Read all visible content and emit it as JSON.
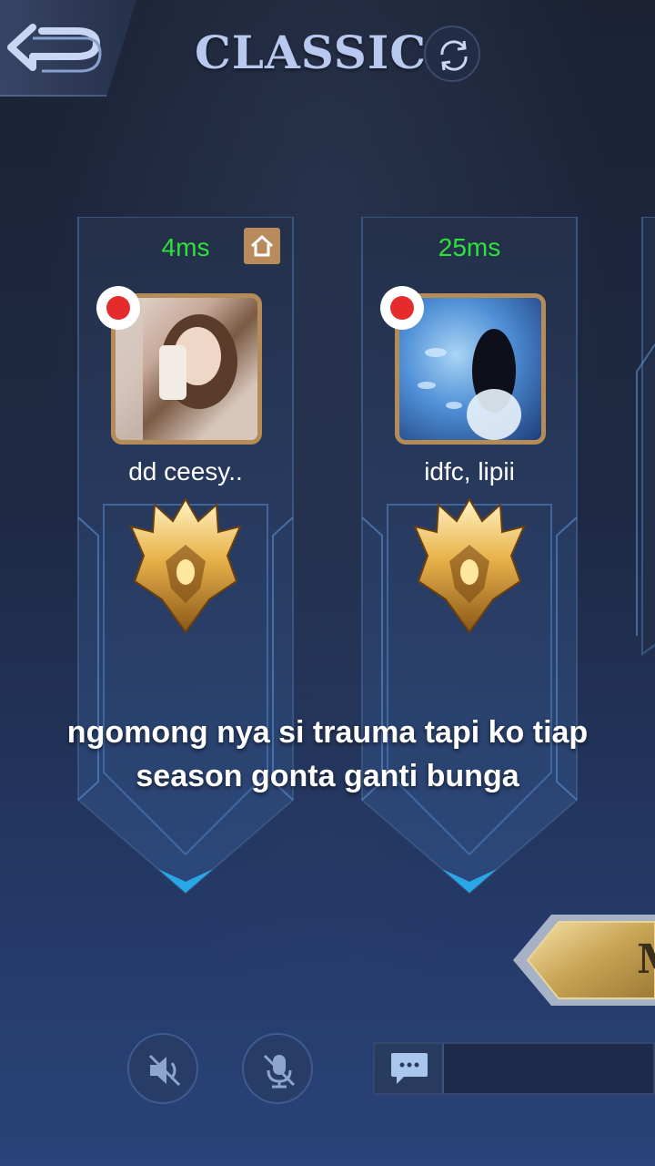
{
  "header": {
    "title": "CLASSIC",
    "back_icon": "back-arrow-icon",
    "swap_icon": "refresh-icon"
  },
  "players": [
    {
      "ping": "4ms",
      "name": "dd ceesy..",
      "is_host": true,
      "recording": true,
      "rank_icon": "mythic-rank-icon"
    },
    {
      "ping": "25ms",
      "name": "idfc, lipii",
      "is_host": false,
      "recording": true,
      "rank_icon": "mythic-rank-icon"
    }
  ],
  "caption": {
    "line1": "ngomong nya si trauma tapi ko tiap",
    "line2": "season gonta ganti bunga"
  },
  "ready_button": {
    "label": "M"
  },
  "controls": {
    "speaker_icon": "speaker-muted-icon",
    "mic_icon": "mic-muted-icon",
    "chat_icon": "chat-bubble-icon"
  },
  "colors": {
    "ping_green": "#2fe03a",
    "title": "#b9c8ee",
    "frame_gold": "#b58c57",
    "record_red": "#e52b2b"
  }
}
